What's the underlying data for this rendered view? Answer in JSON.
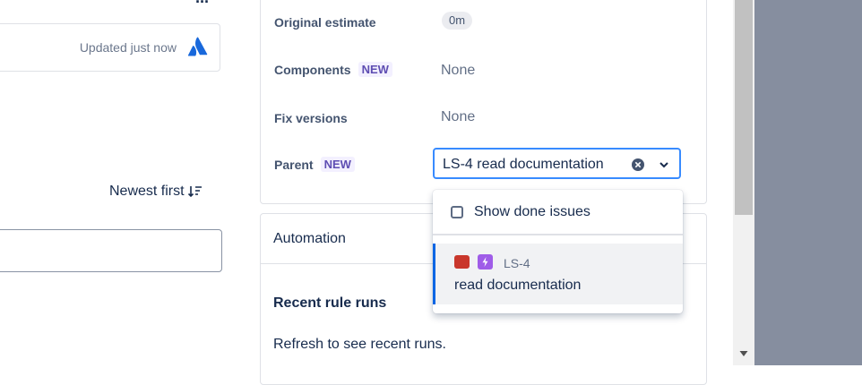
{
  "header": {
    "more_icon": "more-horizontal-icon"
  },
  "updated_card": {
    "text": "Updated just now",
    "logo_icon": "atlassian-logo-icon",
    "logo_color": "#1868db"
  },
  "activity": {
    "sort_label": "Newest first",
    "sort_icon": "sort-descending-icon"
  },
  "details": {
    "fields": [
      {
        "label": "Original estimate",
        "value": "0m",
        "new": false
      },
      {
        "label": "Components",
        "value": "None",
        "new": true
      },
      {
        "label": "Fix versions",
        "value": "None",
        "new": false
      },
      {
        "label": "Parent",
        "value": "LS-4 read documentation",
        "new": true
      }
    ],
    "new_lozenge": "NEW"
  },
  "parent_dropdown": {
    "show_done_label": "Show done issues",
    "show_done_checked": false,
    "options": [
      {
        "key": "LS-4",
        "summary": "read documentation",
        "status_color": "#c9372c",
        "type_icon": "epic-lightning-icon",
        "type_color": "#9f5ce8"
      }
    ]
  },
  "automation": {
    "title": "Automation",
    "recent_runs_title": "Recent rule runs",
    "refresh_text": "Refresh to see recent runs."
  },
  "colors": {
    "accent": "#388bff",
    "selected_border": "#0c66e4",
    "overlay": "#868e9f"
  }
}
